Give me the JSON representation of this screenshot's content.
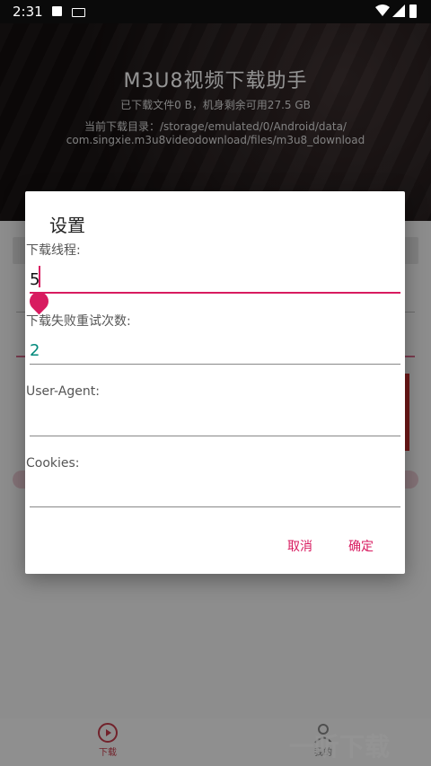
{
  "status_bar": {
    "time": "2:31"
  },
  "hero": {
    "title": "M3U8视频下载助手",
    "stats": "已下载文件0 B，机身剩余可用27.5 GB",
    "dir_line1": "当前下载目录：/storage/emulated/0/Android/data/",
    "dir_line2": "com.singxie.m3u8videodownload/files/m3u8_download"
  },
  "dialog": {
    "title": "设置",
    "threads_label": "下载线程:",
    "threads_value": "5",
    "retry_label": "下载失败重试次数:",
    "retry_value": "2",
    "ua_label": "User-Agent:",
    "ua_value": "",
    "cookies_label": "Cookies:",
    "cookies_value": "",
    "cancel_label": "取消",
    "confirm_label": "确定"
  },
  "bottom_nav": {
    "download_label": "下载",
    "mine_label": "我的"
  },
  "watermark": "一听下载",
  "colors": {
    "accent": "#d81b60",
    "retry_value_color": "#00897b"
  }
}
